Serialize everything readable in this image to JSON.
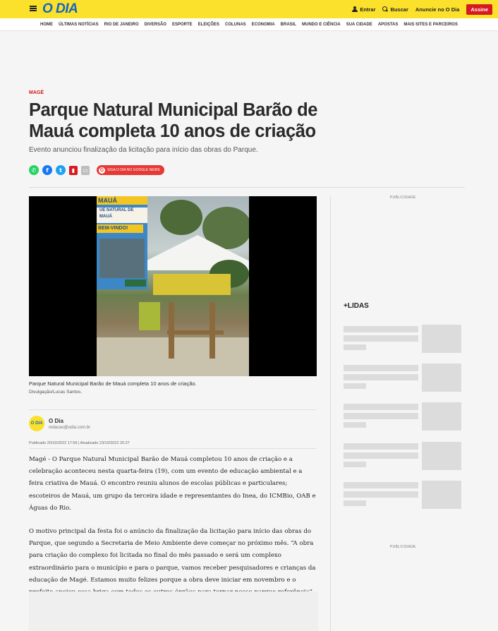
{
  "header": {
    "logo": "O DIA",
    "entrar": "Entrar",
    "buscar": "Buscar",
    "anuncie": "Anuncie no O Dia",
    "assine": "Assine"
  },
  "nav": [
    "HOME",
    "ÚLTIMAS NOTÍCIAS",
    "RIO DE JANEIRO",
    "DIVERSÃO",
    "ESPORTE",
    "ELEIÇÕES",
    "COLUNAS",
    "ECONOMIA",
    "BRASIL",
    "MUNDO E CIÊNCIA",
    "SUA CIDADE",
    "APOSTAS",
    "MAIS SITES E PARCEIROS"
  ],
  "article": {
    "category": "MAGÉ",
    "title": "Parque Natural Municipal Barão de Mauá completa 10 anos de criação",
    "subtitle": "Evento anunciou finalização da licitação para início das obras do Parque.",
    "google_news": "SIGA O DIA NO GOOGLE NEWS",
    "photo": {
      "banner_head": "MAUÁ",
      "banner_text": "UE NATURAL DE MAUÁ",
      "banner_welcome": "BEM-VINDO!"
    },
    "caption": "Parque Natural Municipal Barão de Mauá completa 10 anos de criação.",
    "credit": "Divulgação/Lucas Santos.",
    "author": {
      "avatar": "O DIA",
      "name": "O Dia",
      "email": "redacao@odia.com.br"
    },
    "dates": "Publicado 20/10/2022 17:56 | Atualizado 23/10/2022 20:27",
    "paragraphs": [
      "Magé - O Parque Natural Municipal Barão de Mauá completou 10 anos de criação e a celebração aconteceu nesta quarta-feira (19), com um evento de educação ambiental e a feira criativa de Mauá. O encontro reuniu alunos de escolas públicas e particulares; escoteiros de Mauá, um grupo da terceira idade e representantes do Inea, do ICMBio, OAB e Águas do Rio.",
      "O motivo principal da festa foi o anúncio da finalização da licitação para início das obras do Parque, que segundo a Secretaria de Meio Ambiente deve começar no próximo mês. “A obra para criação do complexo foi licitada no final do mês passado e será um complexo extraordinário para o município e para o parque, vamos receber pesquisadores e crianças da educação de Magé. Estamos muito felizes porque a obra deve iniciar em novembro e o prefeito apoiou essa briga com todos os outros órgãos para tornar nosso parque referência”, conta o secretário de Meio Ambiente, Silvio Furtado."
    ]
  },
  "sidebar": {
    "ad_label": "PUBLICIDADE",
    "lidas_title": "+LIDAS"
  }
}
